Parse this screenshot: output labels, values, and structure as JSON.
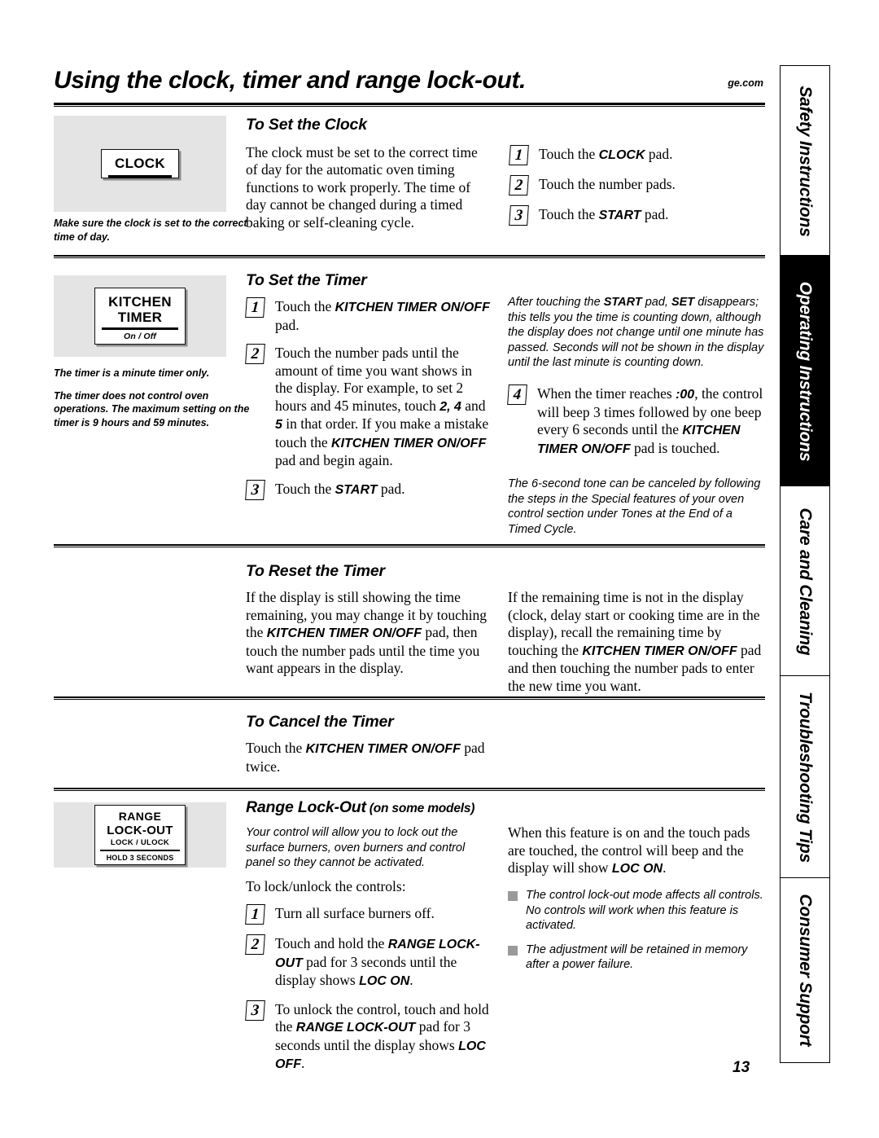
{
  "header": {
    "title": "Using the clock, timer and range lock-out.",
    "site_url": "ge.com"
  },
  "page_number": "13",
  "tabs": [
    {
      "label": "Safety Instructions",
      "active": false
    },
    {
      "label": "Operating Instructions",
      "active": true
    },
    {
      "label": "Care and Cleaning",
      "active": false
    },
    {
      "label": "Troubleshooting Tips",
      "active": false
    },
    {
      "label": "Consumer Support",
      "active": false
    }
  ],
  "pads": {
    "clock": {
      "main": "CLOCK"
    },
    "kitchen_timer": {
      "line1": "KITCHEN",
      "line2": "TIMER",
      "sub": "On / Off"
    },
    "range_lockout": {
      "line1": "RANGE",
      "line2": "LOCK-OUT",
      "line3": "LOCK / ULOCK",
      "line4": "HOLD 3 SECONDS"
    }
  },
  "captions": {
    "clock": "Make sure the clock is set to the correct time of day.",
    "timer_1": "The timer is a minute timer only.",
    "timer_2": "The timer does not control oven operations. The maximum setting on the timer is 9 hours and 59 minutes."
  },
  "sections": {
    "set_clock": {
      "heading": "To Set the Clock",
      "paragraph": "The clock must be set to the correct time of day for the automatic oven timing functions to work properly. The time of day cannot be changed during a timed baking or self-cleaning cycle.",
      "steps": [
        {
          "num": "1",
          "text_html": "Touch the <b class=\"bold-pad\">CLOCK</b> pad."
        },
        {
          "num": "2",
          "text_html": "Touch the number pads."
        },
        {
          "num": "3",
          "text_html": "Touch the <b class=\"bold-pad\">START</b> pad."
        }
      ]
    },
    "set_timer": {
      "heading": "To Set the Timer",
      "steps_left": [
        {
          "num": "1",
          "text_html": "Touch the <b class=\"bold-pad\">KITCHEN TIMER ON/OFF</b> pad."
        },
        {
          "num": "2",
          "text_html": "Touch the number pads until the amount of time you want shows in the display. For example, to set 2 hours and 45 minutes, touch <b class=\"bold-pad\">2, 4</b> and <b class=\"bold-pad\">5</b> in that order. If you make a mistake touch the <b class=\"bold-pad\">KITCHEN TIMER ON/OFF</b> pad and begin again."
        },
        {
          "num": "3",
          "text_html": "Touch the <b class=\"bold-pad\">START</b> pad."
        }
      ],
      "note_top_html": "After touching the <b class=\"bold-pad\">START</b> pad, <b class=\"bold-pad\">SET</b> disappears; this tells you the time is counting down, although the display does not change until one minute has passed. Seconds will not be shown in the display until the last minute is counting down.",
      "step_right": {
        "num": "4",
        "text_html": "When the timer reaches <b class=\"bold-pad\">:00</b>, the control will beep 3 times followed by one beep every 6 seconds until the <b class=\"bold-pad\">KITCHEN TIMER ON/OFF</b> pad is touched."
      },
      "note_bottom_html": "The 6-second tone can be canceled by following the steps in the Special features of your oven control section under Tones at the End of a Timed Cycle."
    },
    "reset_timer": {
      "heading": "To Reset the Timer",
      "left_html": "If the display is still showing the time remaining, you may change it by touching the <b class=\"bold-pad\">KITCHEN TIMER ON/OFF</b> pad, then touch the number pads until the time you want appears in the display.",
      "right_html": "If the remaining time is not in the display (clock, delay start or cooking time are in the display), recall the remaining time by touching the <b class=\"bold-pad\">KITCHEN TIMER ON/OFF</b> pad and then touching the number pads to enter the new time you want."
    },
    "cancel_timer": {
      "heading": "To Cancel the Timer",
      "text_html": "Touch the <b class=\"bold-pad\">KITCHEN TIMER ON/OFF</b> pad twice."
    },
    "range_lockout": {
      "heading_main": "Range Lock-Out",
      "heading_sub": "(on some models)",
      "intro": "Your control will allow you to lock out the surface burners, oven burners and control panel so they cannot be activated.",
      "lead": "To lock/unlock the controls:",
      "steps": [
        {
          "num": "1",
          "text_html": "Turn all surface burners off."
        },
        {
          "num": "2",
          "text_html": "Touch and hold the <b class=\"bold-pad\">RANGE LOCK-OUT</b> pad for 3 seconds until the display shows <b class=\"bold-pad\">LOC ON</b>."
        },
        {
          "num": "3",
          "text_html": "To unlock the control, touch and hold the <b class=\"bold-pad\">RANGE LOCK-OUT</b> pad for 3 seconds until the display shows <b class=\"bold-pad\">LOC OFF</b>."
        }
      ],
      "right_intro_html": "When this feature is on and the touch pads are touched, the control will beep and the display will show <b class=\"bold-pad\">LOC ON</b>.",
      "bullets": [
        "The control lock-out mode affects all controls. No controls will work when this feature is activated.",
        "The adjustment will be retained in memory after a power failure."
      ]
    }
  }
}
